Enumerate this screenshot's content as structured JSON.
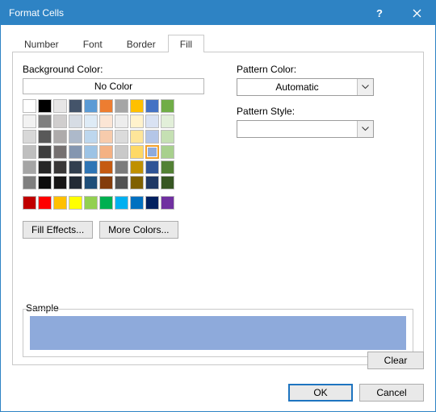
{
  "title": "Format Cells",
  "tabs": {
    "number": "Number",
    "font": "Font",
    "border": "Border",
    "fill": "Fill"
  },
  "left": {
    "bg_label": "Background Color:",
    "nocolor": "No Color",
    "fill_effects": "Fill Effects...",
    "more_colors": "More Colors...",
    "theme_colors": [
      [
        "#ffffff",
        "#000000",
        "#e7e6e6",
        "#44546a",
        "#5b9bd5",
        "#ed7d31",
        "#a5a5a5",
        "#ffc000",
        "#4472c4",
        "#70ad47"
      ],
      [
        "#f2f2f2",
        "#7f7f7f",
        "#d0cece",
        "#d6dce4",
        "#deebf6",
        "#fbe5d5",
        "#ededed",
        "#fff2cc",
        "#d9e2f3",
        "#e2efd9"
      ],
      [
        "#d8d8d8",
        "#595959",
        "#aeabab",
        "#adb9ca",
        "#bdd7ee",
        "#f7cbac",
        "#dbdbdb",
        "#fee599",
        "#b4c6e7",
        "#c5e0b3"
      ],
      [
        "#bfbfbf",
        "#3f3f3f",
        "#757070",
        "#8496b0",
        "#9cc3e5",
        "#f4b183",
        "#c9c9c9",
        "#ffd965",
        "#8eaadb",
        "#a8d08d"
      ],
      [
        "#a5a5a5",
        "#262626",
        "#3a3838",
        "#323f4f",
        "#2e75b5",
        "#c55a11",
        "#7b7b7b",
        "#bf9000",
        "#2f5496",
        "#538135"
      ],
      [
        "#7f7f7f",
        "#0c0c0c",
        "#171616",
        "#222a35",
        "#1e4e79",
        "#833c0b",
        "#525252",
        "#7f6000",
        "#1f3864",
        "#375623"
      ]
    ],
    "standard_colors": [
      "#c00000",
      "#ff0000",
      "#ffc000",
      "#ffff00",
      "#92d050",
      "#00b050",
      "#00b0f0",
      "#0070c0",
      "#002060",
      "#7030a0"
    ],
    "selected_theme": {
      "row": 3,
      "col": 8
    }
  },
  "right": {
    "pattern_color_label": "Pattern Color:",
    "pattern_color_value": "Automatic",
    "pattern_style_label": "Pattern Style:",
    "pattern_style_value": ""
  },
  "sample": {
    "label": "Sample",
    "color": "#8eaadb"
  },
  "buttons": {
    "clear": "Clear",
    "ok": "OK",
    "cancel": "Cancel"
  }
}
